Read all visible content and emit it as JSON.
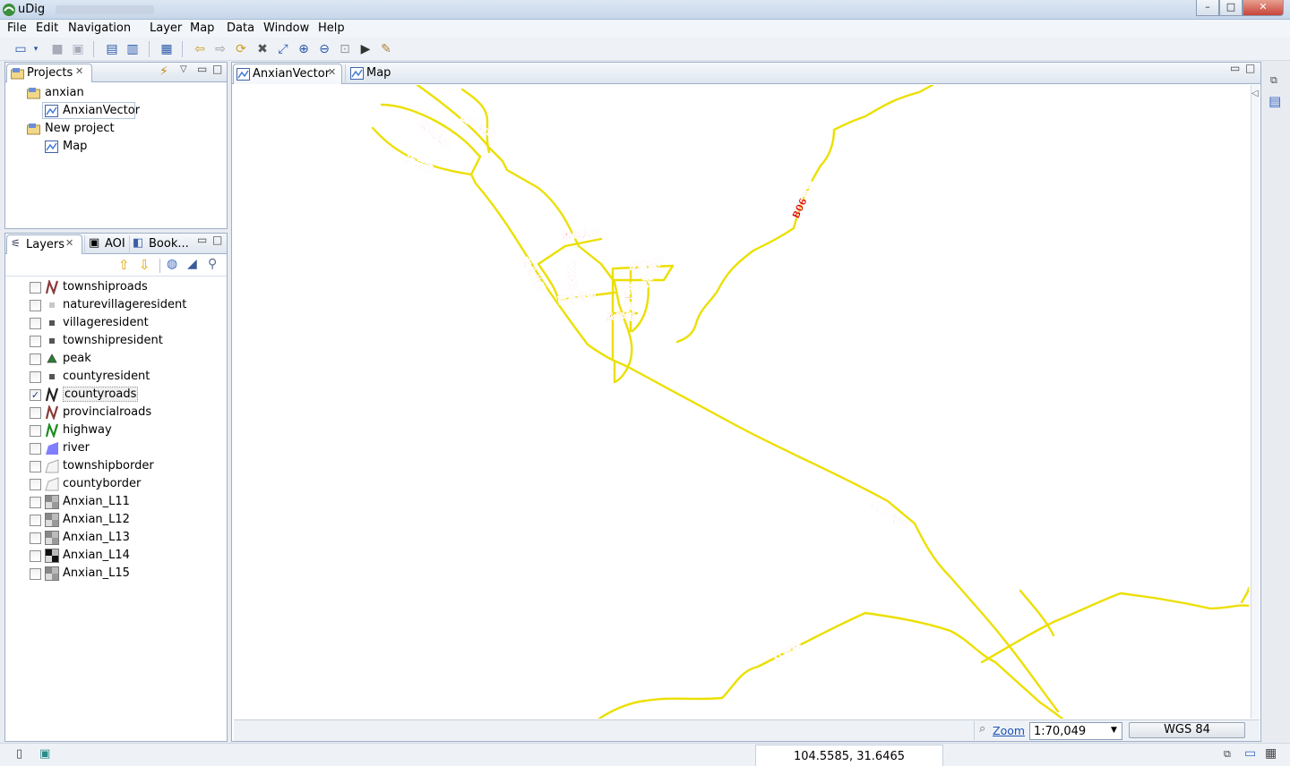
{
  "window": {
    "title": "uDig",
    "min_label": "–",
    "max_label": "□",
    "close_label": "✕"
  },
  "menu": [
    "File",
    "Edit",
    "Navigation",
    "Layer",
    "Map",
    "Data",
    "Window",
    "Help"
  ],
  "projects_panel": {
    "tab_label": "Projects",
    "tree": [
      {
        "label": "anxian",
        "level": 0
      },
      {
        "label": "AnxianVector",
        "level": 1,
        "selected": true
      },
      {
        "label": "New project",
        "level": 0
      },
      {
        "label": "Map",
        "level": 1
      }
    ]
  },
  "layers_panel": {
    "tabs": [
      "Layers",
      "AOI",
      "Book..."
    ],
    "layers": [
      {
        "name": "townshiproads",
        "checked": false,
        "icon": "line-icon",
        "color": "#8b3a3a"
      },
      {
        "name": "naturevillageresident",
        "checked": false,
        "icon": "point-icon",
        "color": "#c8c8c8"
      },
      {
        "name": "villageresident",
        "checked": false,
        "icon": "point-icon",
        "color": "#555555"
      },
      {
        "name": "townshipresident",
        "checked": false,
        "icon": "point-icon",
        "color": "#555555"
      },
      {
        "name": "peak",
        "checked": false,
        "icon": "triangle-icon",
        "color": "#2e7d32"
      },
      {
        "name": "countyresident",
        "checked": false,
        "icon": "point-icon",
        "color": "#555555"
      },
      {
        "name": "countyroads",
        "checked": true,
        "icon": "line-icon",
        "color": "#222222"
      },
      {
        "name": "provincialroads",
        "checked": false,
        "icon": "line-icon",
        "color": "#8b3a3a"
      },
      {
        "name": "highway",
        "checked": false,
        "icon": "line-icon",
        "color": "#1e8c1e"
      },
      {
        "name": "river",
        "checked": false,
        "icon": "polygon-icon",
        "color": "#7f7fff"
      },
      {
        "name": "townshipborder",
        "checked": false,
        "icon": "polygon-outline-icon",
        "color": "#aaaaaa"
      },
      {
        "name": "countyborder",
        "checked": false,
        "icon": "polygon-outline-icon",
        "color": "#aaaaaa"
      },
      {
        "name": "Anxian_L11",
        "checked": false,
        "icon": "raster-icon",
        "color": "#888888"
      },
      {
        "name": "Anxian_L12",
        "checked": false,
        "icon": "raster-icon",
        "color": "#888888"
      },
      {
        "name": "Anxian_L13",
        "checked": false,
        "icon": "raster-icon",
        "color": "#888888"
      },
      {
        "name": "Anxian_L14",
        "checked": false,
        "icon": "raster-icon",
        "color": "#111111"
      },
      {
        "name": "Anxian_L15",
        "checked": false,
        "icon": "raster-icon",
        "color": "#888888"
      }
    ]
  },
  "editor_tabs": [
    {
      "label": "AnxianVector",
      "active": true
    },
    {
      "label": "Map",
      "active": false
    }
  ],
  "map": {
    "road_color": "#ecdf00",
    "label_color": "#e00000",
    "road_labels": [
      "山东大道",
      "安州大道",
      "汐汀路",
      "永昌大道",
      "安北公路",
      "黄川路",
      "龙蕴街",
      "西番南街",
      "永平街",
      "益江路",
      "将军河路",
      "B06县道",
      "辽宁大道",
      "辽安路"
    ]
  },
  "map_footer": {
    "zoom_label": "Zoom",
    "scale": "1:70,049",
    "crs": "WGS 84"
  },
  "status": {
    "coordinates": "104.5585, 31.6465"
  }
}
